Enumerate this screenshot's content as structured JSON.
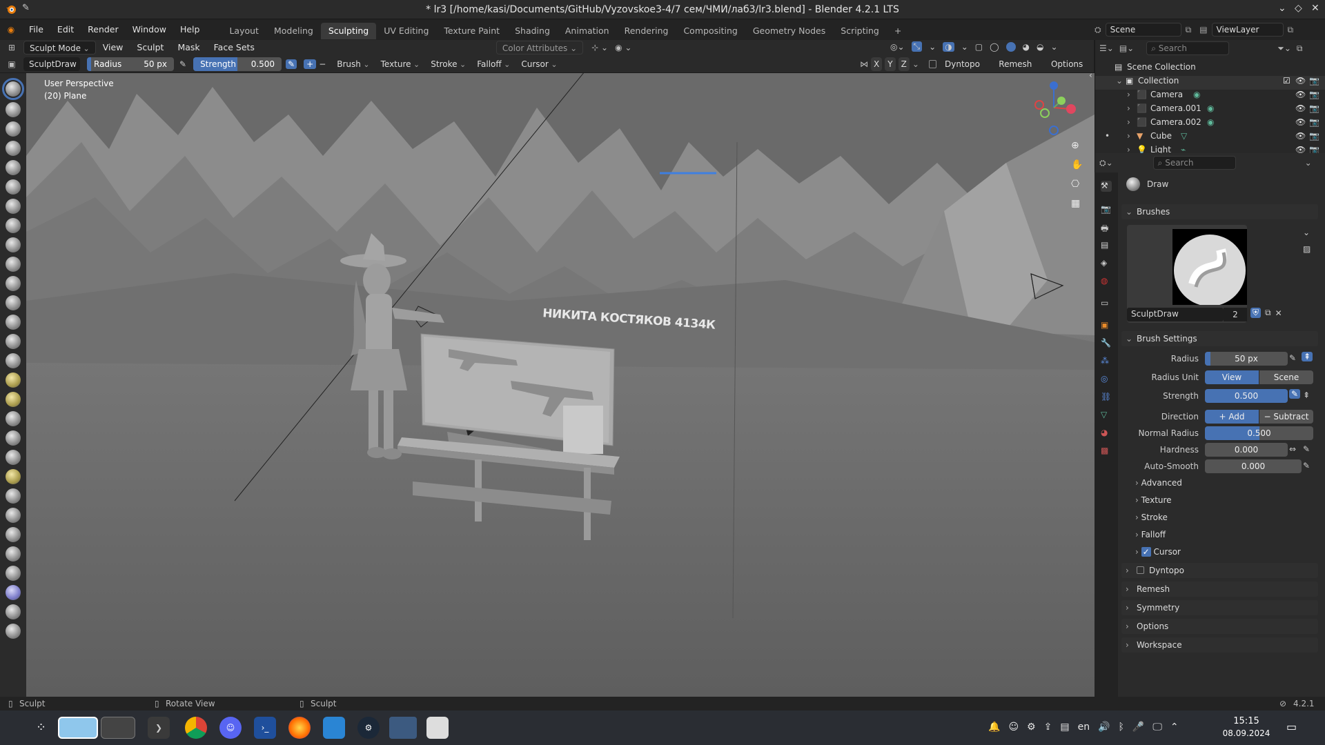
{
  "window": {
    "title": "* lr3 [/home/kasi/Documents/GitHub/Vyzovskoe3-4/7 сем/ЧМИ/лаб3/lr3.blend] - Blender 4.2.1 LTS"
  },
  "menubar": {
    "menus": [
      "File",
      "Edit",
      "Render",
      "Window",
      "Help"
    ],
    "workspaces": [
      "Layout",
      "Modeling",
      "Sculpting",
      "UV Editing",
      "Texture Paint",
      "Shading",
      "Animation",
      "Rendering",
      "Compositing",
      "Geometry Nodes",
      "Scripting"
    ],
    "active_workspace": "Sculpting",
    "scene": "Scene",
    "view_layer": "ViewLayer"
  },
  "header": {
    "mode": "Sculpt Mode",
    "menus": [
      "View",
      "Sculpt",
      "Mask",
      "Face Sets"
    ],
    "color_attributes": "Color Attributes"
  },
  "tool_settings": {
    "brush_name": "SculptDraw",
    "radius_label": "Radius",
    "radius_value": "50 px",
    "strength_label": "Strength",
    "strength_value": "0.500",
    "dropdowns": [
      "Brush",
      "Texture",
      "Stroke",
      "Falloff",
      "Cursor"
    ],
    "axes": [
      "X",
      "Y",
      "Z"
    ],
    "dyntopo": "Dyntopo",
    "remesh": "Remesh",
    "options": "Options"
  },
  "viewport": {
    "perspective": "User Perspective",
    "object": "(20) Plane",
    "board_text": "НИКИТА КОСТЯКОВ 4134К"
  },
  "outliner": {
    "search_placeholder": "Search",
    "scene_collection": "Scene Collection",
    "collection": "Collection",
    "items": [
      "Camera",
      "Camera.001",
      "Camera.002",
      "Cube",
      "Light"
    ]
  },
  "properties": {
    "search_placeholder": "Search",
    "tool_name": "Draw",
    "brushes_header": "Brushes",
    "brush_name": "SculptDraw",
    "brush_users": "2",
    "brush_settings_header": "Brush Settings",
    "radius_label": "Radius",
    "radius_value": "50 px",
    "radius_unit_label": "Radius Unit",
    "radius_unit_options": [
      "View",
      "Scene"
    ],
    "strength_label": "Strength",
    "strength_value": "0.500",
    "direction_label": "Direction",
    "direction_options": [
      "Add",
      "Subtract"
    ],
    "normal_radius_label": "Normal Radius",
    "normal_radius_value": "0.500",
    "normal_radius_fraction": 0.5,
    "hardness_label": "Hardness",
    "hardness_value": "0.000",
    "autosmooth_label": "Auto-Smooth",
    "autosmooth_value": "0.000",
    "subpanels": [
      "Advanced",
      "Texture",
      "Stroke",
      "Falloff",
      "Cursor"
    ],
    "panels": [
      "Dyntopo",
      "Remesh",
      "Symmetry",
      "Options",
      "Workspace"
    ]
  },
  "statusbar": {
    "left": "Sculpt",
    "middle": "Rotate View",
    "right": "Sculpt",
    "version": "4.2.1"
  },
  "taskbar": {
    "lang": "en",
    "time": "15:15",
    "date": "08.09.2024"
  },
  "colors": {
    "accent": "#4772b3",
    "viewport_bg": "#6d6d6d",
    "panel_bg": "#2b2b2b"
  }
}
